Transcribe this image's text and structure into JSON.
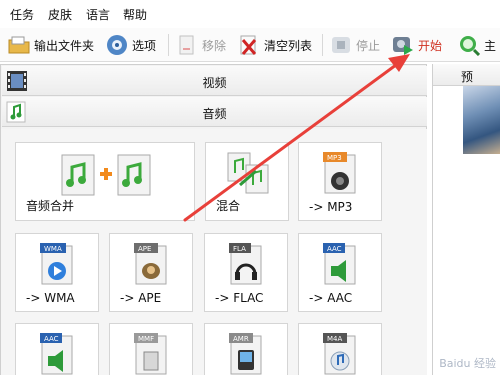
{
  "menu": [
    "任务",
    "皮肤",
    "语言",
    "帮助"
  ],
  "toolbar": {
    "output_folder": "输出文件夹",
    "options": "选项",
    "remove": "移除",
    "clear_list": "清空列表",
    "stop": "停止",
    "start": "开始",
    "main": "主"
  },
  "categories": {
    "video": "视频",
    "audio": "音频"
  },
  "tiles": [
    {
      "label": "音频合并",
      "icon": "audio-merge-icon",
      "badge": ""
    },
    {
      "label": "混合",
      "icon": "audio-mix-icon",
      "badge": ""
    },
    {
      "label": "-> MP3",
      "icon": "mp3-file-icon",
      "badge": "MP3"
    },
    {
      "label": "-> WMA",
      "icon": "wma-file-icon",
      "badge": "WMA"
    },
    {
      "label": "-> APE",
      "icon": "ape-file-icon",
      "badge": "APE"
    },
    {
      "label": "-> FLAC",
      "icon": "flac-file-icon",
      "badge": "FLA"
    },
    {
      "label": "-> AAC",
      "icon": "aac-file-icon",
      "badge": "AAC"
    },
    {
      "label": "",
      "icon": "aac-file-icon",
      "badge": "AAC"
    },
    {
      "label": "",
      "icon": "mmf-file-icon",
      "badge": "MMF"
    },
    {
      "label": "",
      "icon": "amr-file-icon",
      "badge": "AMR"
    },
    {
      "label": "",
      "icon": "m4a-file-icon",
      "badge": "M4A"
    }
  ],
  "preview": {
    "header": "预"
  },
  "watermark": "Baidu 经验",
  "colors": {
    "annotation_arrow": "#e8403a",
    "start_text": "#d03020"
  }
}
